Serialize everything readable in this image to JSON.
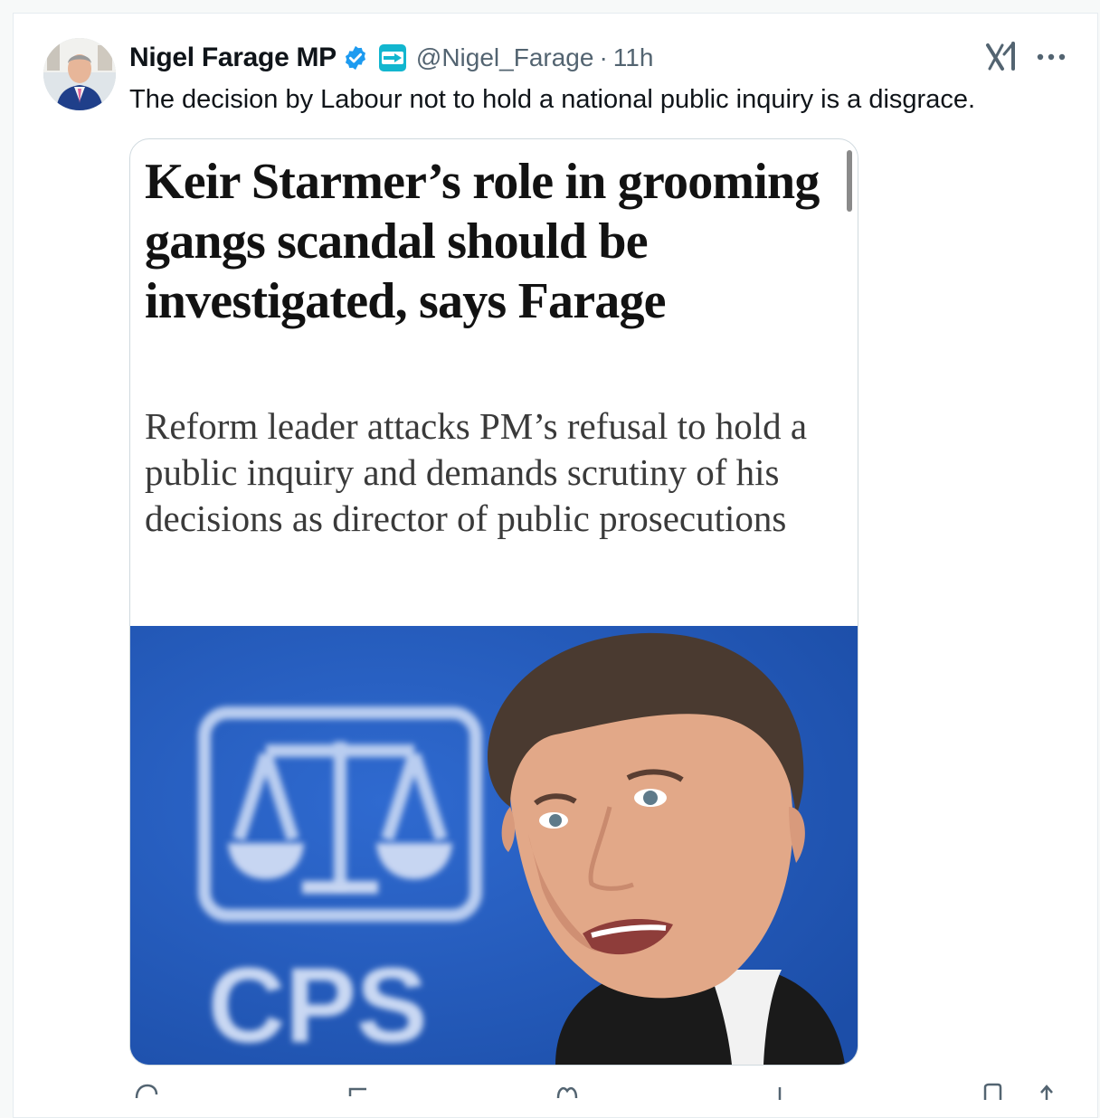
{
  "tweet": {
    "author": {
      "display_name": "Nigel Farage MP",
      "handle": "@Nigel_Farage",
      "separator": "·",
      "time": "11h",
      "verified_icon": "verified-badge-icon",
      "affiliation_icon": "reform-uk-badge-icon"
    },
    "text": "The decision by Labour not to hold a national public inquiry is a disgrace.",
    "article": {
      "headline": "Keir Starmer’s role in grooming gangs scandal should be investigated, says Farage",
      "standfirst": "Reform leader attacks PM’s refusal to hold a public inquiry and demands scrutiny of his decisions as director of public prosecutions",
      "image": {
        "logo_text": "CPS",
        "subject": "man speaking in front of CPS logo"
      }
    },
    "toolbar_icons": [
      "grok-icon",
      "more-icon"
    ],
    "actions": [
      "reply-icon",
      "repost-icon",
      "like-icon",
      "views-icon",
      "bookmark-icon",
      "share-icon"
    ]
  },
  "colors": {
    "verified_blue": "#1d9bf0",
    "photo_background": "#1f56b6",
    "secondary_text": "#536471"
  }
}
